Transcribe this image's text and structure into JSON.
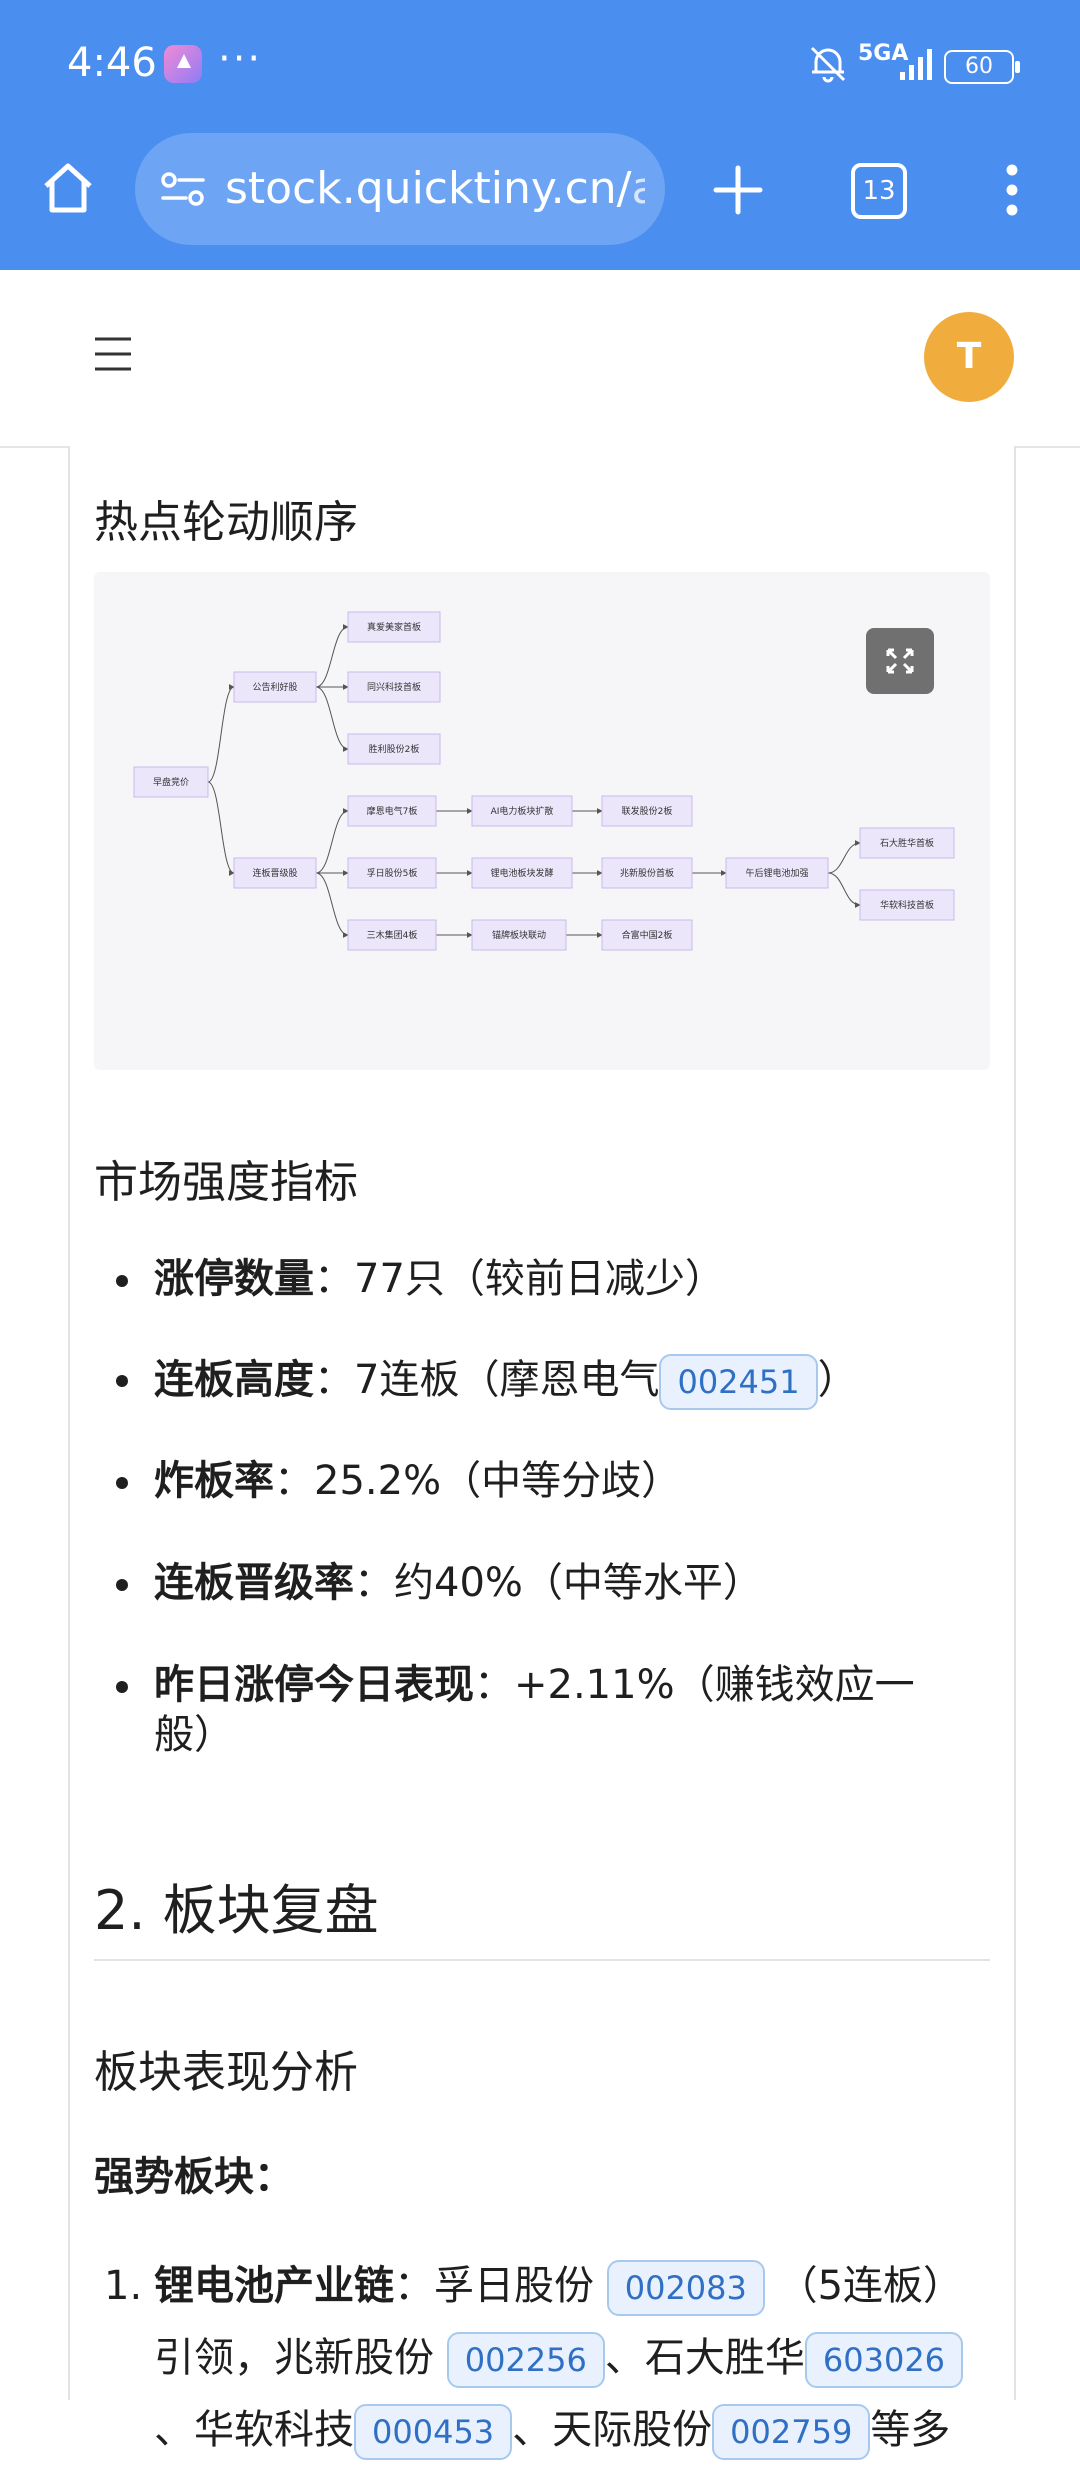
{
  "status_bar": {
    "time": "4:46",
    "more": "···",
    "network": "5GA",
    "battery": "60"
  },
  "browser": {
    "url_main": "stock.quicktiny.cn/",
    "url_fade": "ai",
    "tab_count": "13"
  },
  "header": {
    "avatar_letter": "T"
  },
  "sections": {
    "rotation_title": "热点轮动顺序",
    "strength_title": "市场强度指标",
    "review_title": "2. 板块复盘",
    "analysis_title": "板块表现分析",
    "strong_label": "强势板块："
  },
  "diagram": {
    "nodes": [
      "早盘竞价",
      "公告利好股",
      "连板晋级股",
      "真爱美家首板",
      "同兴科技首板",
      "胜利股份2板",
      "摩恩电气7板",
      "孚日股份5板",
      "三木集团4板",
      "AI电力板块扩散",
      "锂电池板块发酵",
      "锚牌板块联动",
      "联发股份2板",
      "兆新股份首板",
      "合富中国2板",
      "午后锂电池加强",
      "石大胜华首板",
      "华软科技首板"
    ]
  },
  "metrics": [
    {
      "label": "涨停数量",
      "sep": "：",
      "value": "77只（较前日减少）"
    },
    {
      "label": "连板高度",
      "sep": "：",
      "value": "7连板（摩恩电气",
      "code": "002451",
      "after": "）"
    },
    {
      "label": "炸板率",
      "sep": "：",
      "value": "25.2%（中等分歧）"
    },
    {
      "label": "连板晋级率",
      "sep": "：",
      "value": "约40%（中等水平）"
    },
    {
      "label": "昨日涨停今日表现",
      "sep": "：",
      "value": "+2.11%（赚钱效应一般）"
    }
  ],
  "sectors": [
    {
      "num": "1.",
      "label": "锂电池产业链",
      "sep": "：",
      "s1": "孚日股份",
      "c1": "002083",
      "t1": "（5连板）引领，兆新股份",
      "c2": "002256",
      "t2": "、石大胜华",
      "c3": "603026",
      "t3": "、华软科技",
      "c4": "000453",
      "t4": "、天际股份",
      "c5": "002759",
      "t5": "等多"
    }
  ],
  "colors": {
    "chrome": "#4a8ef0",
    "urlbar": "#6da5f4",
    "avatar": "#f0ad3e",
    "chip_bg": "#e8f1fd",
    "chip_text": "#2f6fc4"
  }
}
